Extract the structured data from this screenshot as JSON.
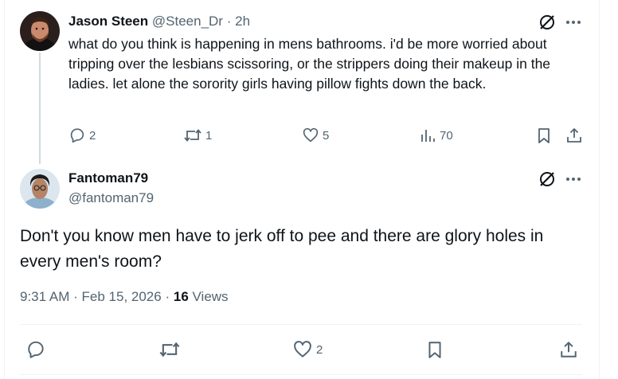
{
  "reply": {
    "author_name": "Jason Steen",
    "handle": "@Steen_Dr",
    "separator": "·",
    "time": "2h",
    "text": "what do you think is happening in mens bathrooms.  i'd be more worried about tripping over the lesbians scissoring, or the strippers doing their makeup in the ladies.  let alone the sorority girls having pillow fights down the back.",
    "reply_count": "2",
    "repost_count": "1",
    "like_count": "5",
    "view_count": "70"
  },
  "main": {
    "author_name": "Fantoman79",
    "handle": "@fantoman79",
    "text": "Don't you know men have to jerk off to pee and there are glory holes in every men's room?",
    "time": "9:31 AM",
    "separator": "·",
    "date": "Feb 15, 2026",
    "separator2": "·",
    "views_count": "16",
    "views_label": "Views",
    "like_count": "2"
  },
  "colors": {
    "text_primary": "#0f1419",
    "text_secondary": "#536471",
    "border": "#eff3f4",
    "thread_line": "#cfd9de"
  },
  "icons": [
    "grok-icon",
    "more-icon",
    "reply-icon",
    "repost-icon",
    "like-icon",
    "views-icon",
    "bookmark-icon",
    "share-icon"
  ]
}
